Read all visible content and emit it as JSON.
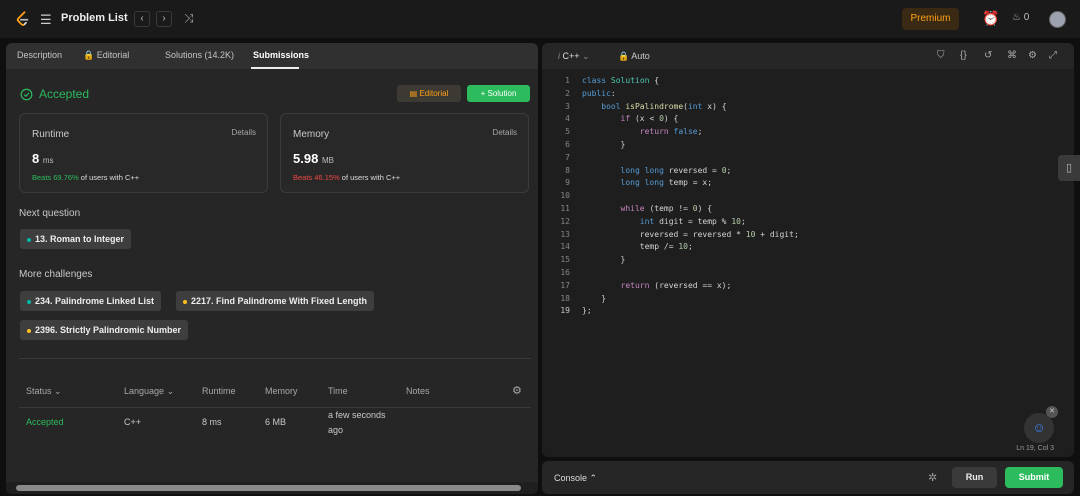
{
  "topbar": {
    "title": "Problem List",
    "prev": "‹",
    "next": "›",
    "shuffle": "⤨",
    "premium": "Premium",
    "streak": "0",
    "icons": {
      "logo": "leetcode-logo",
      "list": "list-icon",
      "alarm": "alarm-icon",
      "flame": "flame-icon"
    }
  },
  "tabs": [
    {
      "label": "Description"
    },
    {
      "label": "Editorial"
    },
    {
      "label": "Solutions (14.2K)"
    },
    {
      "label": "Submissions"
    }
  ],
  "result": {
    "status": "Accepted",
    "editorial_btn": "Editorial",
    "solution_btn": "Solution"
  },
  "runtime": {
    "title": "Runtime",
    "details": "Details",
    "value": "8",
    "unit": "ms",
    "beats": "Beats 69.76%",
    "rest": "of users with C++"
  },
  "memory": {
    "title": "Memory",
    "details": "Details",
    "value": "5.98",
    "unit": "MB",
    "beats": "Beats 46.15%",
    "rest": "of users with C++"
  },
  "next_question": {
    "title": "Next question",
    "item": "13. Roman to Integer"
  },
  "more_challenges": {
    "title": "More challenges",
    "items": [
      "234. Palindrome Linked List",
      "2217. Find Palindrome With Fixed Length",
      "2396. Strictly Palindromic Number"
    ]
  },
  "table": {
    "headers": [
      "Status",
      "Language",
      "Runtime",
      "Memory",
      "Time",
      "Notes"
    ],
    "row": {
      "status": "Accepted",
      "language": "C++",
      "runtime": "8 ms",
      "memory": "6 MB",
      "time_line1": "a few seconds",
      "time_line2": "ago"
    }
  },
  "editor": {
    "language": "C++",
    "mode": "Auto",
    "cursor": "Ln 19, Col 3"
  },
  "console": {
    "label": "Console",
    "run": "Run",
    "submit": "Submit"
  },
  "colors": {
    "accent_green": "#2cbb5d",
    "accent_orange": "#ffa116",
    "beats_red": "#ef4743"
  }
}
